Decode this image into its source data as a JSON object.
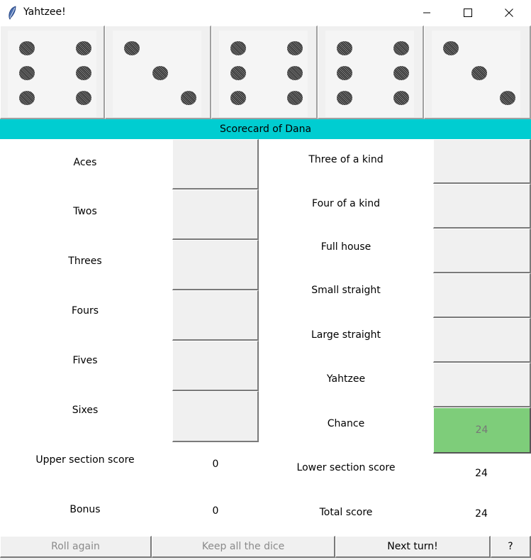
{
  "window": {
    "title": "Yahtzee!",
    "icon": "feather-icon",
    "controls": [
      "minimize-icon",
      "maximize-icon",
      "close-icon"
    ]
  },
  "dice": [
    {
      "value": 6
    },
    {
      "value": 3
    },
    {
      "value": 6
    },
    {
      "value": 6
    },
    {
      "value": 3
    }
  ],
  "scorecard": {
    "title": "Scorecard of Dana",
    "header_color": "#00cdd1",
    "upper": {
      "categories": [
        {
          "label": "Aces",
          "score": ""
        },
        {
          "label": "Twos",
          "score": ""
        },
        {
          "label": "Threes",
          "score": ""
        },
        {
          "label": "Fours",
          "score": ""
        },
        {
          "label": "Fives",
          "score": ""
        },
        {
          "label": "Sixes",
          "score": ""
        }
      ],
      "section_score_label": "Upper section score",
      "section_score_value": "0",
      "bonus_label": "Bonus",
      "bonus_value": "0"
    },
    "lower": {
      "categories": [
        {
          "label": "Three of a kind",
          "score": ""
        },
        {
          "label": "Four of a kind",
          "score": ""
        },
        {
          "label": "Full house",
          "score": ""
        },
        {
          "label": "Small straight",
          "score": ""
        },
        {
          "label": "Large straight",
          "score": ""
        },
        {
          "label": "Yahtzee",
          "score": ""
        },
        {
          "label": "Chance",
          "score": "24",
          "selected": true
        }
      ],
      "section_score_label": "Lower section score",
      "section_score_value": "24",
      "total_label": "Total score",
      "total_value": "24"
    },
    "selected_color": "#7ecd7a"
  },
  "buttons": {
    "roll_again": "Roll again",
    "keep_all": "Keep all the dice",
    "next_turn": "Next turn!",
    "help": "?"
  }
}
